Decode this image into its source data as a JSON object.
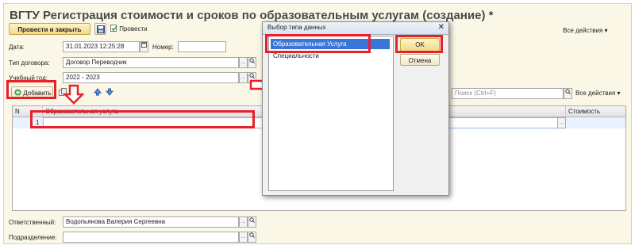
{
  "form": {
    "title": "ВГТУ Регистрация стоимости и сроков по образовательным услугам (создание) *",
    "toolbar": {
      "post_close": "Провести и закрыть",
      "post": "Провести",
      "all_actions": "Все действия ▾"
    },
    "date": {
      "label": "Дата:",
      "value": "31.01.2023 12:25:28"
    },
    "number": {
      "label": "Номер:",
      "value": ""
    },
    "contract_type": {
      "label": "Тип договора:",
      "value": "Договор Переводчик"
    },
    "academic_year": {
      "label": "Учебный год:",
      "value": "2022 - 2023"
    },
    "table_toolbar": {
      "add": "Добавить",
      "search_placeholder": "Поиск (Ctrl+F)",
      "all_actions": "Все действия ▾"
    },
    "table": {
      "columns": [
        "N",
        "Образовательная услуга",
        "Стоимость"
      ],
      "rows": [
        {
          "n": "1",
          "service": "",
          "cost": ""
        }
      ]
    },
    "responsible": {
      "label": "Ответственный:",
      "value": "Водопьянова Валерия Сергеевна"
    },
    "department": {
      "label": "Подразделение:",
      "value": ""
    }
  },
  "dialog": {
    "title": "Выбор типа данных",
    "close": "✕",
    "items": [
      "Образовательная Услуга",
      "Специальности"
    ],
    "selected_index": 0,
    "ok": "OK",
    "cancel": "Отмена"
  },
  "colors": {
    "highlight": "#e8202a",
    "selection": "#3a76d8",
    "form_bg": "#fbf7e6"
  }
}
